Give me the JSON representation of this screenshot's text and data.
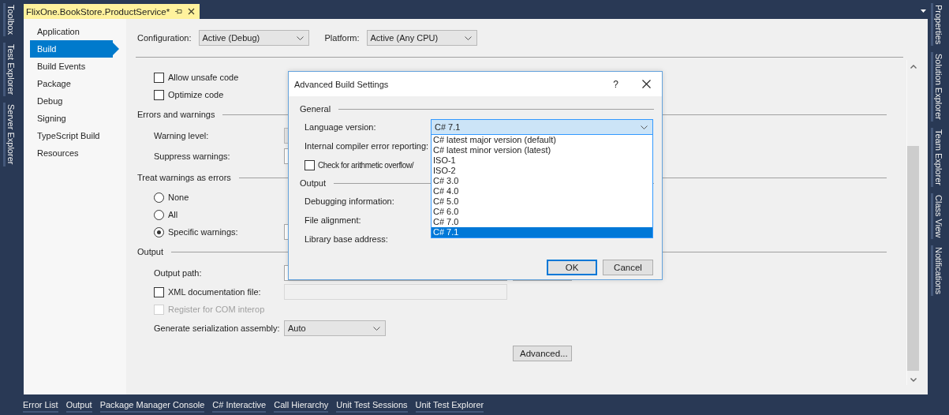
{
  "left_tool_tabs": [
    "Toolbox",
    "Test Explorer",
    "Server Explorer"
  ],
  "document_tab": {
    "title": "FlixOne.BookStore.ProductService*",
    "selected": true
  },
  "nav": [
    {
      "label": "Application",
      "selected": false
    },
    {
      "label": "Build",
      "selected": true
    },
    {
      "label": "Build Events",
      "selected": false
    },
    {
      "label": "Package",
      "selected": false
    },
    {
      "label": "Debug",
      "selected": false
    },
    {
      "label": "Signing",
      "selected": false
    },
    {
      "label": "TypeScript Build",
      "selected": false
    },
    {
      "label": "Resources",
      "selected": false
    }
  ],
  "configuration": {
    "label": "Configuration:",
    "value": "Active (Debug)"
  },
  "platform": {
    "label": "Platform:",
    "value": "Active (Any CPU)"
  },
  "settings": [
    {
      "kind": "checkbox",
      "label": "Allow unsafe code",
      "checked": false,
      "disabled": false
    },
    {
      "kind": "checkbox",
      "label": "Optimize code",
      "checked": false,
      "disabled": false
    },
    {
      "kind": "section",
      "label": "Errors and warnings"
    },
    {
      "kind": "select_row",
      "label": "Warning level:"
    },
    {
      "kind": "field_row",
      "label": "Suppress warnings:"
    },
    {
      "kind": "section",
      "label": "Treat warnings as errors"
    },
    {
      "kind": "radio",
      "label": "None",
      "selected": false
    },
    {
      "kind": "radio",
      "label": "All",
      "selected": false
    },
    {
      "kind": "radio_field_row",
      "label": "Specific warnings:",
      "selected": true
    },
    {
      "kind": "section",
      "label": "Output"
    },
    {
      "kind": "field_button_row",
      "label": "Output path:"
    },
    {
      "kind": "checkbox_field_row",
      "label": "XML documentation file:",
      "checked": false,
      "disabled": false
    },
    {
      "kind": "checkbox",
      "label": "Register for COM interop",
      "checked": false,
      "disabled": true
    },
    {
      "kind": "select_row",
      "label": "Generate serialization assembly:",
      "value": "Auto"
    },
    {
      "kind": "button",
      "label": "Advanced..."
    }
  ],
  "dialog": {
    "title": "Advanced Build Settings",
    "help": "?",
    "sections": [
      {
        "label": "General",
        "rows": [
          {
            "kind": "select",
            "label": "Language version:",
            "value": "C# 7.1",
            "open": true
          },
          {
            "kind": "label",
            "label": "Internal compiler error reporting:"
          },
          {
            "kind": "checkbox",
            "label": "Check for arithmetic overflow/",
            "checked": false
          }
        ]
      },
      {
        "label": "Output",
        "rows": [
          {
            "kind": "label",
            "label": "Debugging information:"
          },
          {
            "kind": "label",
            "label": "File alignment:"
          },
          {
            "kind": "label",
            "label": "Library base address:"
          }
        ]
      }
    ],
    "language_options": [
      {
        "label": "C# latest major version (default)",
        "selected": false
      },
      {
        "label": "C# latest minor version (latest)",
        "selected": false
      },
      {
        "label": "ISO-1",
        "selected": false
      },
      {
        "label": "ISO-2",
        "selected": false
      },
      {
        "label": "C# 3.0",
        "selected": false
      },
      {
        "label": "C# 4.0",
        "selected": false
      },
      {
        "label": "C# 5.0",
        "selected": false
      },
      {
        "label": "C# 6.0",
        "selected": false
      },
      {
        "label": "C# 7.0",
        "selected": false
      },
      {
        "label": "C# 7.1",
        "selected": true
      }
    ],
    "buttons": [
      {
        "label": "OK",
        "default": true
      },
      {
        "label": "Cancel",
        "default": false
      }
    ]
  },
  "right_tool_tabs": [
    "Properties",
    "Solution Explorer",
    "Team Explorer",
    "Class View",
    "Notifications"
  ],
  "bottom_tool_tabs": [
    "Error List",
    "Output",
    "Package Manager Console",
    "C# Interactive",
    "Call Hierarchy",
    "Unit Test Sessions",
    "Unit Test Explorer"
  ]
}
